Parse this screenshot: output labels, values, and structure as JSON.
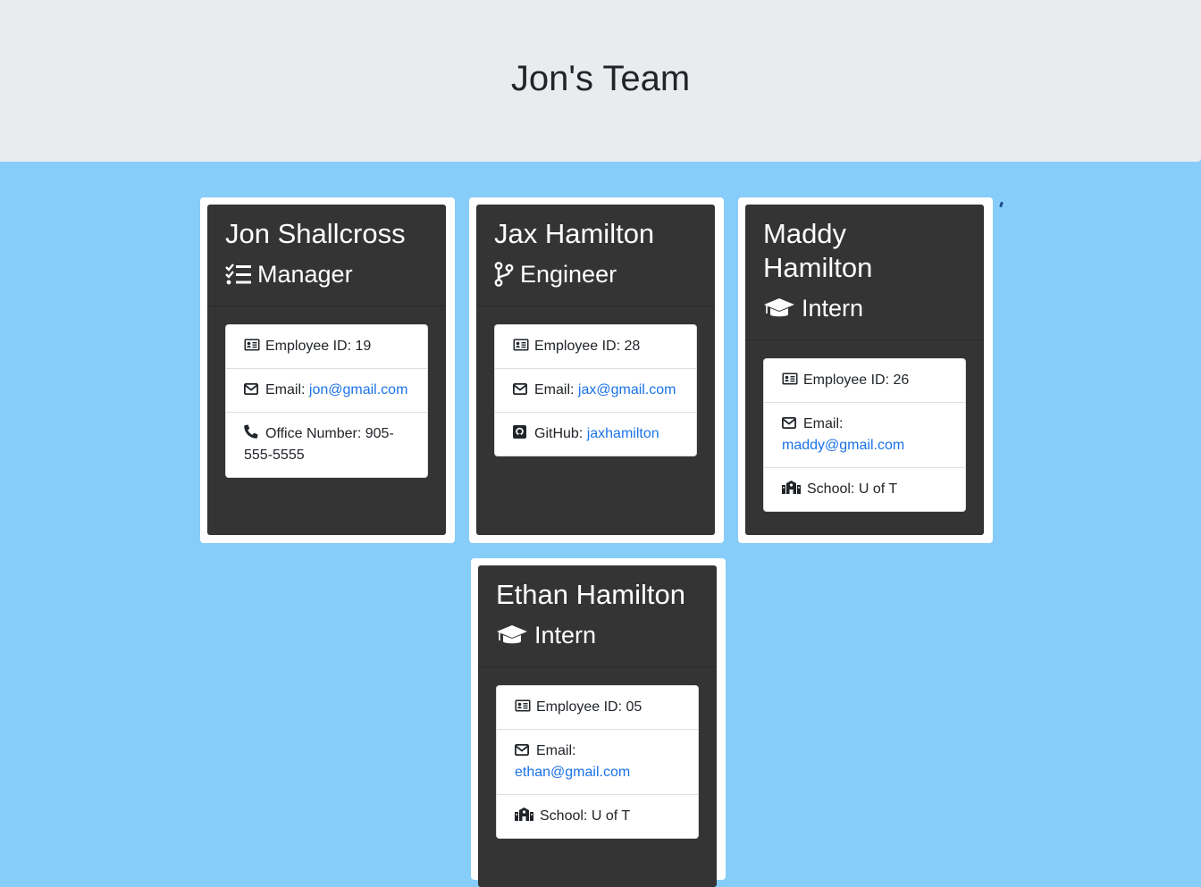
{
  "page": {
    "title": "Jon's Team"
  },
  "colors": {
    "background": "#87cdfa",
    "header": "#e9ecef",
    "card": "#343434",
    "link": "#1a73e8"
  },
  "cards": [
    {
      "name": "Jon Shallcross",
      "role": "Manager",
      "role_icon": "tasks-icon",
      "items": [
        {
          "icon": "id-card-icon",
          "label": "Employee ID: 19"
        },
        {
          "icon": "envelope-icon",
          "label": "Email: ",
          "link": "jon@gmail.com"
        },
        {
          "icon": "phone-icon",
          "label": "Office Number: 905-555-5555"
        }
      ]
    },
    {
      "name": "Jax Hamilton",
      "role": "Engineer",
      "role_icon": "code-branch-icon",
      "items": [
        {
          "icon": "id-card-icon",
          "label": "Employee ID: 28"
        },
        {
          "icon": "envelope-icon",
          "label": "Email: ",
          "link": "jax@gmail.com"
        },
        {
          "icon": "github-icon",
          "label": "GitHub: ",
          "link": "jaxhamilton"
        }
      ]
    },
    {
      "name": "Maddy Hamilton",
      "role": "Intern",
      "role_icon": "graduation-cap-icon",
      "items": [
        {
          "icon": "id-card-icon",
          "label": "Employee ID: 26"
        },
        {
          "icon": "envelope-icon",
          "label": "Email: ",
          "link": "maddy@gmail.com"
        },
        {
          "icon": "school-icon",
          "label": "School: U of T"
        }
      ]
    },
    {
      "name": "Ethan Hamilton",
      "role": "Intern",
      "role_icon": "graduation-cap-icon",
      "items": [
        {
          "icon": "id-card-icon",
          "label": "Employee ID: 05"
        },
        {
          "icon": "envelope-icon",
          "label": "Email: ",
          "link": "ethan@gmail.com"
        },
        {
          "icon": "school-icon",
          "label": "School: U of T"
        }
      ]
    }
  ]
}
